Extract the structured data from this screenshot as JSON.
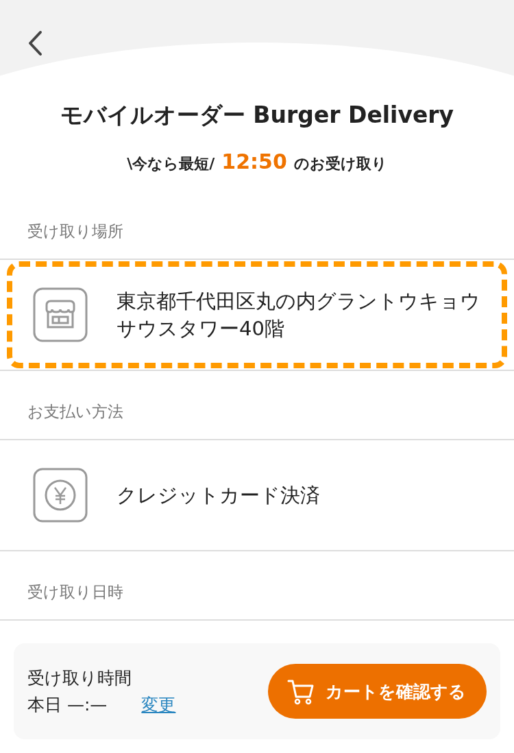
{
  "header": {
    "title": "モバイルオーダー Burger Delivery",
    "lead": {
      "prefix": "\\今なら最短/",
      "time": "12:50",
      "suffix": "のお受け取り"
    }
  },
  "sections": [
    {
      "kind": "location",
      "label": "受け取り場所",
      "value": "東京都千代田区丸の内グラントウキョウサウスタワー40階",
      "highlighted": true
    },
    {
      "kind": "payment",
      "label": "お支払い方法",
      "value": "クレジットカード決済",
      "highlighted": false
    },
    {
      "kind": "schedule",
      "label": "受け取り日時"
    }
  ],
  "footer": {
    "label": "受け取り時間",
    "value": "本日 —:—",
    "change_link": "変更",
    "cart_button": "カートを確認する"
  }
}
